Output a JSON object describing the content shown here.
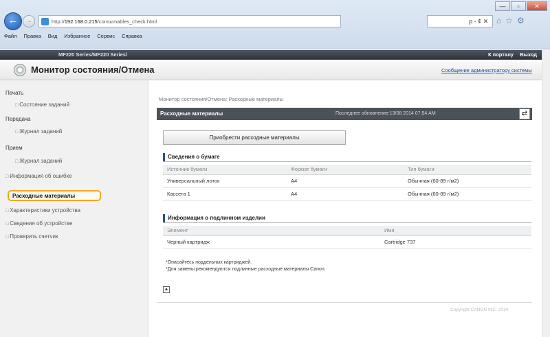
{
  "browser": {
    "address_prefix": "http://",
    "address_host": "192.168.0.215",
    "address_path": "/consumables_check.html",
    "search_text": "ρ - ¢ ✕",
    "window_buttons": [
      "—",
      "▫",
      "✕"
    ],
    "menu": [
      "Файл",
      "Правка",
      "Вид",
      "Избранное",
      "Сервис",
      "Справка"
    ]
  },
  "header": {
    "model": "MF220 Series/MF220 Series/",
    "portal_link": "К порталу",
    "logout": "Выход",
    "page_title": "Монитор состояния/Отмена",
    "admin_message": "Сообщение администратору системы"
  },
  "sidebar": {
    "groups": [
      {
        "label": "Печать",
        "items": [
          "Состояние заданий"
        ]
      },
      {
        "label": "Передача",
        "items": [
          "Журнал заданий"
        ]
      },
      {
        "label": "Прием",
        "items": [
          "Журнал заданий"
        ]
      }
    ],
    "top_items": [
      "Информация об ошибке",
      "Расходные материалы",
      "Характеристики устройства",
      "Сведения об устройстве",
      "Проверить счетчик"
    ]
  },
  "main": {
    "breadcrumb": "Монитор состояния/Отмена: Расходные материалы",
    "panel_title": "Расходные материалы",
    "last_update": "Последнее обновление:13/08 2014 07:54 AM",
    "buy_button": "Приобрести расходные материалы",
    "paper_section": "Сведения о бумаге",
    "paper_headers": [
      "Источник бумаги",
      "Формат бумаги",
      "Тип бумаги"
    ],
    "paper_rows": [
      [
        "Универсальный лоток",
        "A4",
        "Обычная (60-89 г/м2)"
      ],
      [
        "Кассета 1",
        "A4",
        "Обычная (60-89 г/м2)"
      ]
    ],
    "cartridge_section": "Информация о подлинном изделии",
    "cartridge_headers": [
      "Элемент",
      "Имя"
    ],
    "cartridge_rows": [
      [
        "Черный картридж",
        "Cartridge 737"
      ]
    ],
    "note1": "*Опасайтесь поддельных картриджей.",
    "note2": "*Для замены рекомендуются подлинные расходные материалы Canon.",
    "copyright": "Copyright CANON INC. 2014"
  }
}
